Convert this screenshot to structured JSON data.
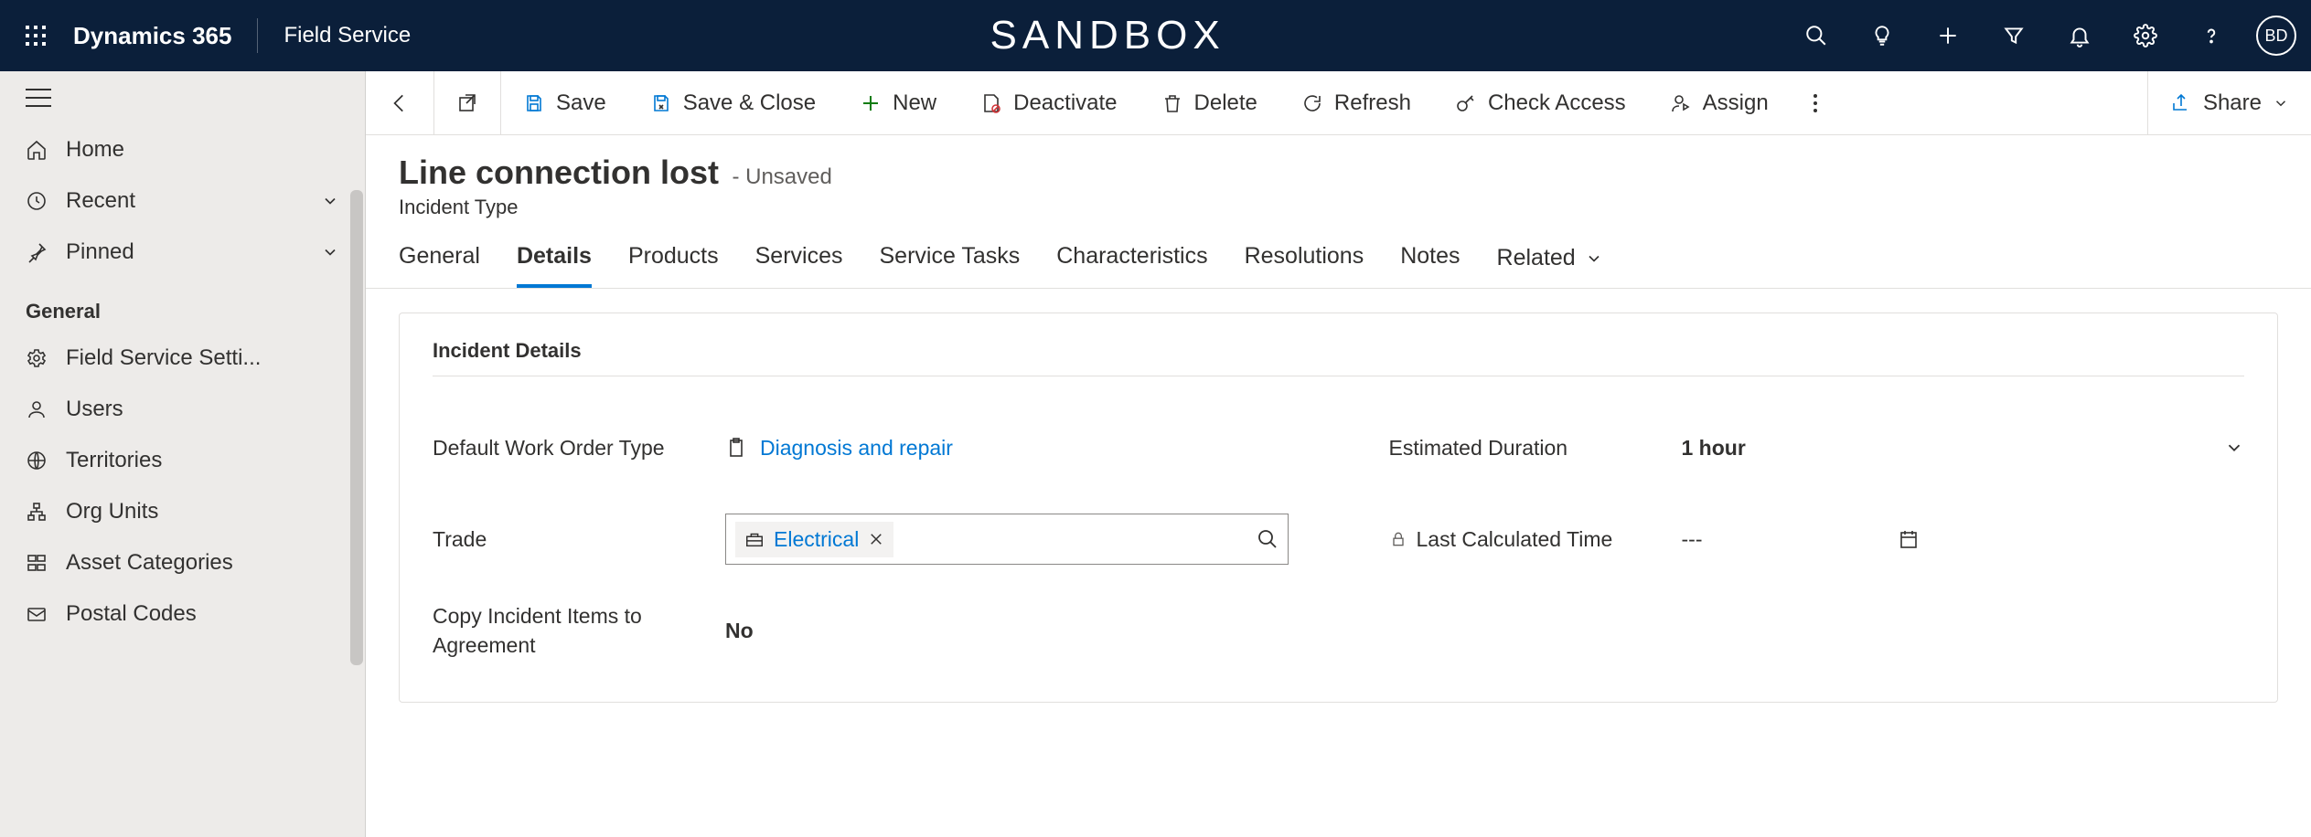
{
  "topbar": {
    "brand": "Dynamics 365",
    "app": "Field Service",
    "env": "SANDBOX",
    "avatar": "BD"
  },
  "sidebar": {
    "home": "Home",
    "recent": "Recent",
    "pinned": "Pinned",
    "section": "General",
    "items": [
      "Field Service Setti...",
      "Users",
      "Territories",
      "Org Units",
      "Asset Categories",
      "Postal Codes"
    ]
  },
  "commands": {
    "save": "Save",
    "save_close": "Save & Close",
    "new": "New",
    "deactivate": "Deactivate",
    "delete": "Delete",
    "refresh": "Refresh",
    "check_access": "Check Access",
    "assign": "Assign",
    "share": "Share"
  },
  "record": {
    "title": "Line connection lost",
    "unsaved": "- Unsaved",
    "entity": "Incident Type"
  },
  "tabs": {
    "general": "General",
    "details": "Details",
    "products": "Products",
    "services": "Services",
    "service_tasks": "Service Tasks",
    "characteristics": "Characteristics",
    "resolutions": "Resolutions",
    "notes": "Notes",
    "related": "Related"
  },
  "card": {
    "title": "Incident Details",
    "fields": {
      "default_wo_type": {
        "label": "Default Work Order Type",
        "value": "Diagnosis and repair"
      },
      "trade": {
        "label": "Trade",
        "value": "Electrical"
      },
      "copy_items": {
        "label": "Copy Incident Items to Agreement",
        "value": "No"
      },
      "est_duration": {
        "label": "Estimated Duration",
        "value": "1 hour"
      },
      "last_calc": {
        "label": "Last Calculated Time",
        "value": "---"
      }
    }
  }
}
